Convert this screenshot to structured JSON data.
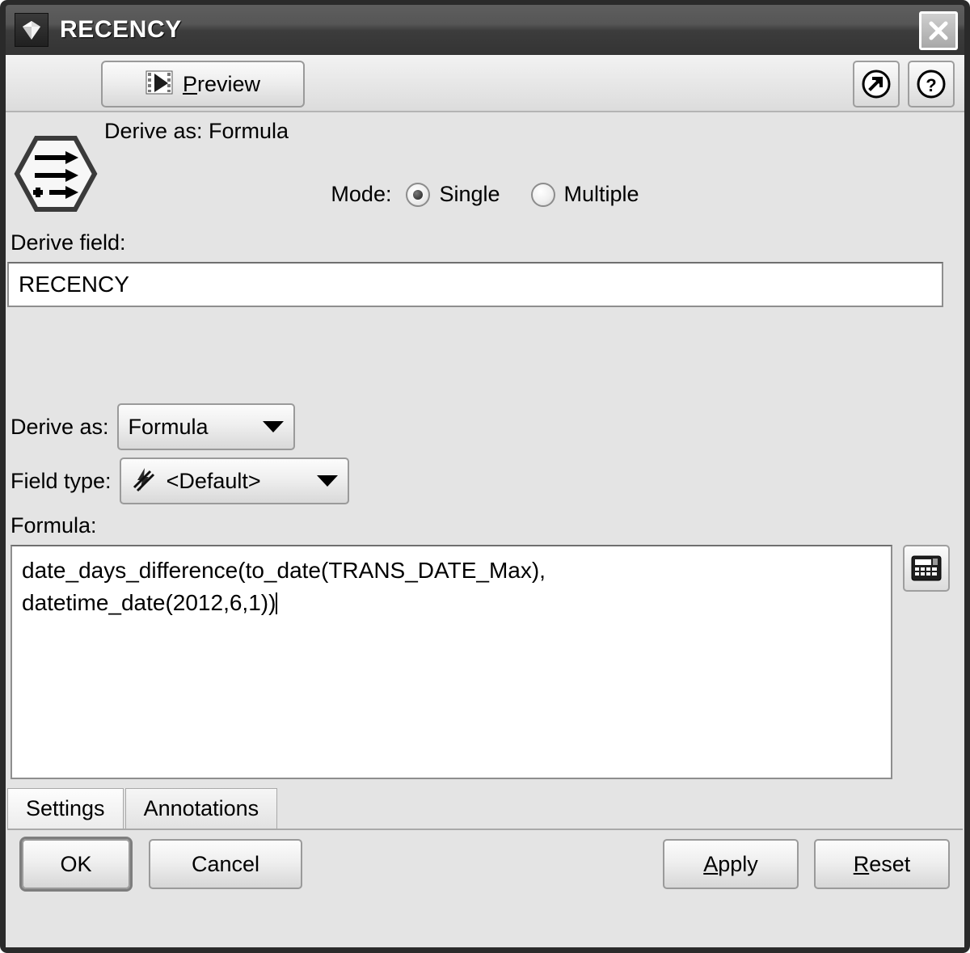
{
  "window": {
    "title": "RECENCY",
    "title_icon": "gem-icon",
    "close_label": "✕"
  },
  "toolbar": {
    "preview_label_prefix": "P",
    "preview_label_rest": "review",
    "preview_icon": "film-play-icon",
    "expand_icon": "expand-arrow-icon",
    "help_icon": "help-question-icon"
  },
  "node": {
    "icon": "derive-node-icon",
    "status": "Derive as: Formula"
  },
  "mode": {
    "label": "Mode:",
    "options": [
      {
        "label": "Single",
        "selected": true
      },
      {
        "label": "Multiple",
        "selected": false
      }
    ]
  },
  "derive_field": {
    "label": "Derive field:",
    "value": "RECENCY"
  },
  "derive_as": {
    "label": "Derive as:",
    "value": "Formula"
  },
  "field_type": {
    "label": "Field type:",
    "value": "<Default>",
    "icon": "lightning-default-icon"
  },
  "formula": {
    "label": "Formula:",
    "value": "date_days_difference(to_date(TRANS_DATE_Max),\ndatetime_date(2012,6,1))",
    "calculator_icon": "calculator-icon"
  },
  "tabs": [
    {
      "label": "Settings",
      "active": true
    },
    {
      "label": "Annotations",
      "active": false
    }
  ],
  "buttons": {
    "ok": "OK",
    "cancel": "Cancel",
    "apply_mnemonic": "A",
    "apply_rest": "pply",
    "reset_mnemonic": "R",
    "reset_rest": "eset"
  },
  "colors": {
    "titlebar_dark": "#343434",
    "panel_bg": "#e4e4e4",
    "window_border": "#2a2a2a",
    "field_bg": "#ffffff"
  }
}
